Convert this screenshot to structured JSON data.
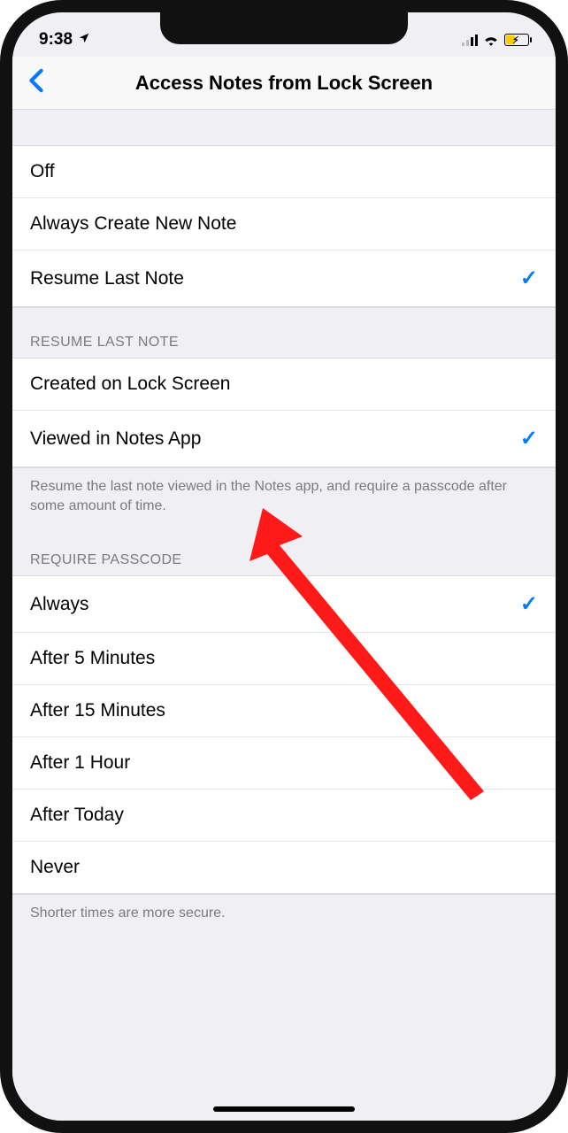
{
  "status": {
    "time": "9:38",
    "location_icon": "location-arrow-icon"
  },
  "nav": {
    "title": "Access Notes from Lock Screen"
  },
  "sections": {
    "main_options": [
      {
        "label": "Off",
        "checked": false
      },
      {
        "label": "Always Create New Note",
        "checked": false
      },
      {
        "label": "Resume Last Note",
        "checked": true
      }
    ],
    "resume_header": "RESUME LAST NOTE",
    "resume_options": [
      {
        "label": "Created on Lock Screen",
        "checked": false
      },
      {
        "label": "Viewed in Notes App",
        "checked": true
      }
    ],
    "resume_footer": "Resume the last note viewed in the Notes app, and require a passcode after some amount of time.",
    "passcode_header": "REQUIRE PASSCODE",
    "passcode_options": [
      {
        "label": "Always",
        "checked": true
      },
      {
        "label": "After 5 Minutes",
        "checked": false
      },
      {
        "label": "After 15 Minutes",
        "checked": false
      },
      {
        "label": "After 1 Hour",
        "checked": false
      },
      {
        "label": "After Today",
        "checked": false
      },
      {
        "label": "Never",
        "checked": false
      }
    ],
    "passcode_footer": "Shorter times are more secure."
  },
  "annotation": {
    "target_option": "Viewed in Notes App"
  }
}
